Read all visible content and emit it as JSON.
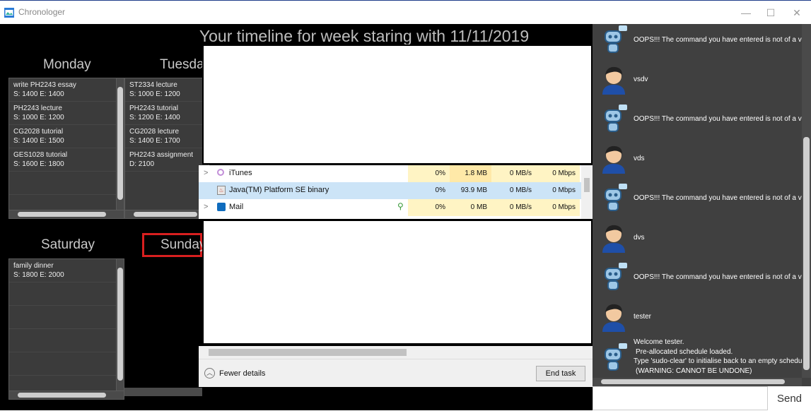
{
  "window": {
    "title": "Chronologer",
    "minimize": "—",
    "maximize": "☐",
    "close": "✕"
  },
  "timeline_title": "Your timeline for week staring with 11/11/2019",
  "days": {
    "monday": {
      "label": "Monday",
      "tasks": [
        {
          "name": "write PH2243 essay",
          "time": "S: 1400 E: 1400"
        },
        {
          "name": "PH2243 lecture",
          "time": "S: 1000 E: 1200"
        },
        {
          "name": "CG2028 tutorial",
          "time": "S: 1400 E: 1500"
        },
        {
          "name": "GES1028 tutorial",
          "time": "S: 1600 E: 1800"
        }
      ]
    },
    "tuesday": {
      "label": "Tuesday",
      "tasks": [
        {
          "name": "ST2334 lecture",
          "time": "S: 1000 E: 1200"
        },
        {
          "name": "PH2243 tutorial",
          "time": "S: 1200 E: 1400"
        },
        {
          "name": "CG2028 lecture",
          "time": "S: 1400 E: 1700"
        },
        {
          "name": "PH2243 assignment",
          "time": "D: 2100"
        }
      ]
    },
    "saturday": {
      "label": "Saturday",
      "tasks": [
        {
          "name": "family dinner",
          "time": "S: 1800 E: 2000"
        }
      ]
    },
    "sunday": {
      "label": "Sunday",
      "tasks": []
    }
  },
  "task_manager": {
    "rows": [
      {
        "name": "iTunes",
        "cpu": "0%",
        "memory": "1.8 MB",
        "disk": "0 MB/s",
        "network": "0 Mbps",
        "expand": ">"
      },
      {
        "name": "Java(TM) Platform SE binary",
        "cpu": "0%",
        "memory": "93.9 MB",
        "disk": "0 MB/s",
        "network": "0 Mbps",
        "expand": ""
      },
      {
        "name": "Mail",
        "cpu": "0%",
        "memory": "0 MB",
        "disk": "0 MB/s",
        "network": "0 Mbps",
        "expand": ">"
      }
    ],
    "fewer_details": "Fewer details",
    "end_task": "End task"
  },
  "chat": {
    "messages": [
      {
        "sender": "bot",
        "text": "OOPS!!! The command you have entered is not of a valid format."
      },
      {
        "sender": "user",
        "text": "vsdv"
      },
      {
        "sender": "bot",
        "text": "OOPS!!! The command you have entered is not of a valid format."
      },
      {
        "sender": "user",
        "text": "vds"
      },
      {
        "sender": "bot",
        "text": "OOPS!!! The command you have entered is not of a valid format."
      },
      {
        "sender": "user",
        "text": "dvs"
      },
      {
        "sender": "bot",
        "text": "OOPS!!! The command you have entered is not of a valid format."
      },
      {
        "sender": "user",
        "text": "tester"
      }
    ],
    "welcome": {
      "line1": "Welcome tester.",
      "line2": "Pre-allocated schedule loaded.",
      "line3": "Type 'sudo-clear' to initialise back to an empty schedule.",
      "line4": "(WARNING: CANNOT BE UNDONE)"
    },
    "input_value": "",
    "send_label": "Send"
  }
}
